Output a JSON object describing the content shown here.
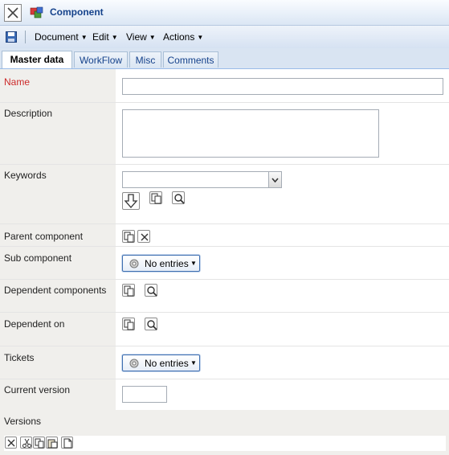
{
  "window": {
    "title": "Component"
  },
  "menu": [
    {
      "label": "Document"
    },
    {
      "label": "Edit"
    },
    {
      "label": "View"
    },
    {
      "label": "Actions"
    }
  ],
  "tabs": [
    {
      "label": "Master data",
      "active": true
    },
    {
      "label": "WorkFlow",
      "active": false
    },
    {
      "label": "Misc",
      "active": false
    },
    {
      "label": "Comments",
      "active": false
    }
  ],
  "form": {
    "name": {
      "label": "Name",
      "value": "",
      "required": true
    },
    "description": {
      "label": "Description",
      "value": ""
    },
    "keywords": {
      "label": "Keywords",
      "value": ""
    },
    "parent_component": {
      "label": "Parent component"
    },
    "sub_component": {
      "label": "Sub component",
      "button": "No entries"
    },
    "dependent_components": {
      "label": "Dependent components"
    },
    "dependent_on": {
      "label": "Dependent on"
    },
    "tickets": {
      "label": "Tickets",
      "button": "No entries"
    },
    "current_version": {
      "label": "Current version",
      "value": ""
    },
    "versions": {
      "label": "Versions"
    }
  },
  "colors": {
    "required_label": "#cc2a2a",
    "title_text": "#15428b",
    "accent_border": "#3f6fb0"
  },
  "icons": [
    "close-icon",
    "component-icon",
    "save-icon",
    "add-icon",
    "copy-icon",
    "search-icon",
    "remove-icon",
    "gear-icon",
    "cut-icon",
    "paste-icon",
    "new-document-icon"
  ]
}
